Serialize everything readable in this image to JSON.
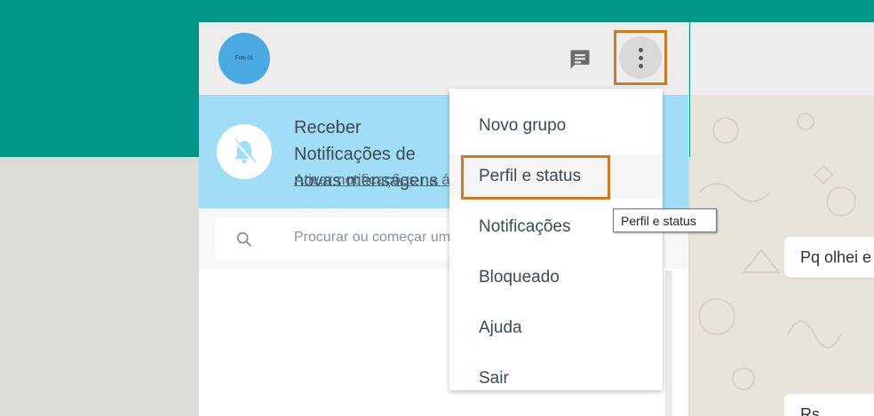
{
  "header": {
    "avatar_text": "Foto 01"
  },
  "banner": {
    "title": "Receber Notificações de novas mensagens",
    "link": "Ativar notificações na área de trabalho"
  },
  "search": {
    "placeholder": "Procurar ou começar uma nova conversa"
  },
  "menu": {
    "items": [
      {
        "label": "Novo grupo"
      },
      {
        "label": "Perfil e status"
      },
      {
        "label": "Notificações"
      },
      {
        "label": "Bloqueado"
      },
      {
        "label": "Ajuda"
      },
      {
        "label": "Sair"
      }
    ]
  },
  "tooltip": {
    "text": "Perfil e status"
  },
  "conversation": {
    "messages": [
      {
        "text": "Pq olhei e"
      },
      {
        "text": "Rs"
      }
    ]
  },
  "colors": {
    "brand_teal": "#009688",
    "banner_blue": "#a2ddf8",
    "highlight_orange": "#d27a1f"
  }
}
